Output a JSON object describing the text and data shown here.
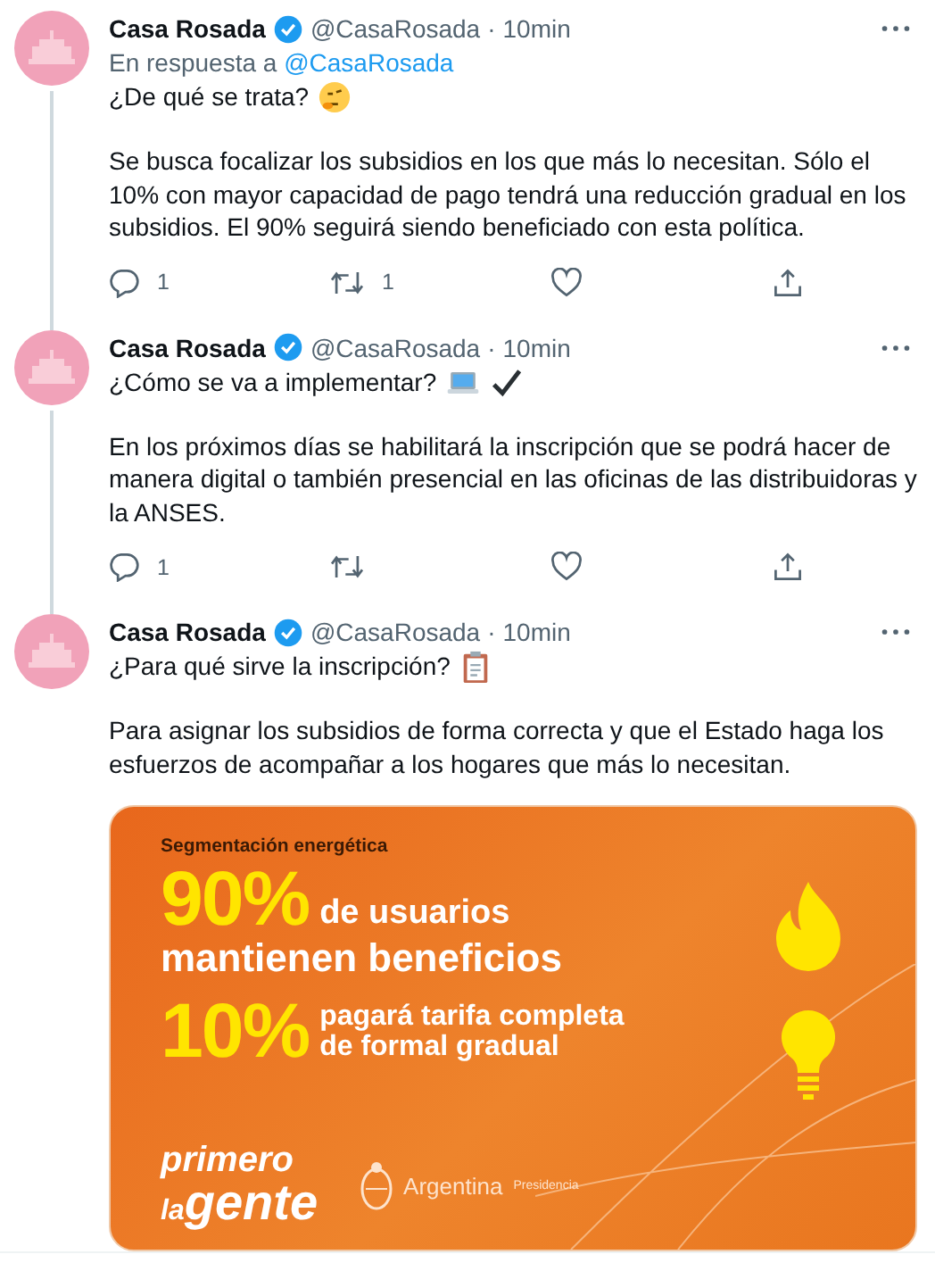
{
  "tweets": [
    {
      "name": "Casa Rosada",
      "verified": true,
      "handle": "@CasaRosada",
      "sep": "·",
      "time": "10min",
      "reply_to": {
        "prefix": "En respuesta a",
        "handle": "@CasaRosada"
      },
      "thread_below": true,
      "lead": "¿De qué se trata?",
      "icons": [
        {
          "kind": "thinking"
        }
      ],
      "body": "Se busca focalizar los subsidios en los que más lo necesitan. Sólo el 10% con mayor capacidad de pago tendrá una reducción gradual en los subsidios. El 90% seguirá siendo beneficiado con esta política.",
      "actions": {
        "replies": "1",
        "retweets": "1",
        "liked": false
      }
    },
    {
      "name": "Casa Rosada",
      "verified": true,
      "handle": "@CasaRosada",
      "sep": "·",
      "time": "10min",
      "thread_below": true,
      "lead": "¿Cómo se va a implementar?",
      "icons": [
        {
          "kind": "laptop"
        },
        {
          "kind": "check"
        }
      ],
      "body": "En los próximos días se habilitará la inscripción que se podrá hacer de manera digital o también presencial en las oficinas de las distribuidoras y la ANSES.",
      "actions": {
        "replies": "1",
        "liked": false
      }
    },
    {
      "name": "Casa Rosada",
      "verified": true,
      "handle": "@CasaRosada",
      "sep": "·",
      "time": "10min",
      "thread_below": false,
      "lead": "¿Para qué sirve la inscripción?",
      "icons": [
        {
          "kind": "clipboard"
        }
      ],
      "body": "Para asignar los subsidios de forma correcta y que el Estado haga los esfuerzos de acompañar a los hogares que más lo necesitan.",
      "card": {
        "title": "Segmentación energética",
        "stat1": {
          "value": "90%",
          "line1": "de usuarios",
          "line2": "mantienen beneficios"
        },
        "stat2": {
          "value": "10%",
          "line1": "pagará tarifa completa",
          "line2": "de formal gradual"
        },
        "slogan1": "primero",
        "slogan2a": "la",
        "slogan2b": "gente",
        "brand": "Argentina",
        "brand_sub": "Presidencia"
      }
    }
  ]
}
